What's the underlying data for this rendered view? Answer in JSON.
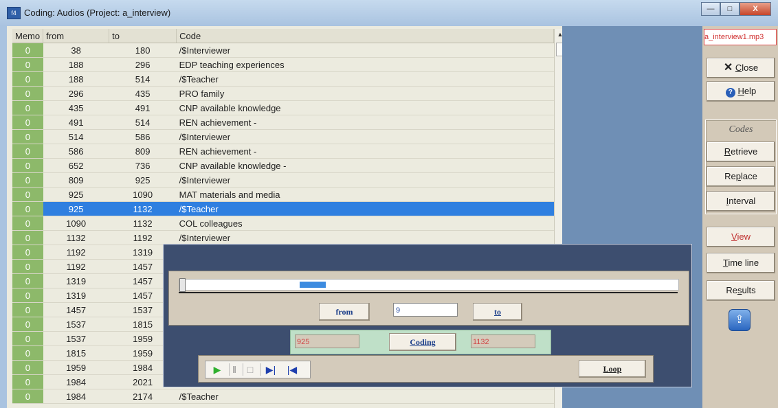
{
  "window": {
    "title": "Coding: Audios (Project: a_interview)",
    "buttons": {
      "minimize": "—",
      "maximize": "□",
      "close": "X"
    }
  },
  "table": {
    "headers": {
      "memo": "Memo",
      "from": "from",
      "to": "to",
      "code": "Code"
    },
    "rows": [
      {
        "memo": "0",
        "from": "38",
        "to": "180",
        "code": "/$Interviewer"
      },
      {
        "memo": "0",
        "from": "188",
        "to": "296",
        "code": "EDP teaching experiences"
      },
      {
        "memo": "0",
        "from": "188",
        "to": "514",
        "code": "/$Teacher"
      },
      {
        "memo": "0",
        "from": "296",
        "to": "435",
        "code": "PRO family"
      },
      {
        "memo": "0",
        "from": "435",
        "to": "491",
        "code": "CNP available knowledge"
      },
      {
        "memo": "0",
        "from": "491",
        "to": "514",
        "code": "REN achievement -"
      },
      {
        "memo": "0",
        "from": "514",
        "to": "586",
        "code": "/$Interviewer"
      },
      {
        "memo": "0",
        "from": "586",
        "to": "809",
        "code": "REN achievement -"
      },
      {
        "memo": "0",
        "from": "652",
        "to": "736",
        "code": "CNP available knowledge -"
      },
      {
        "memo": "0",
        "from": "809",
        "to": "925",
        "code": "/$Interviewer"
      },
      {
        "memo": "0",
        "from": "925",
        "to": "1090",
        "code": "MAT materials and media"
      },
      {
        "memo": "0",
        "from": "925",
        "to": "1132",
        "code": "/$Teacher"
      },
      {
        "memo": "0",
        "from": "1090",
        "to": "1132",
        "code": "COL colleagues"
      },
      {
        "memo": "0",
        "from": "1132",
        "to": "1192",
        "code": "/$Interviewer"
      },
      {
        "memo": "0",
        "from": "1192",
        "to": "1319",
        "code": ""
      },
      {
        "memo": "0",
        "from": "1192",
        "to": "1457",
        "code": ""
      },
      {
        "memo": "0",
        "from": "1319",
        "to": "1457",
        "code": ""
      },
      {
        "memo": "0",
        "from": "1319",
        "to": "1457",
        "code": ""
      },
      {
        "memo": "0",
        "from": "1457",
        "to": "1537",
        "code": ""
      },
      {
        "memo": "0",
        "from": "1537",
        "to": "1815",
        "code": ""
      },
      {
        "memo": "0",
        "from": "1537",
        "to": "1959",
        "code": ""
      },
      {
        "memo": "0",
        "from": "1815",
        "to": "1959",
        "code": ""
      },
      {
        "memo": "0",
        "from": "1959",
        "to": "1984",
        "code": ""
      },
      {
        "memo": "0",
        "from": "1984",
        "to": "2021",
        "code": ""
      },
      {
        "memo": "0",
        "from": "1984",
        "to": "2174",
        "code": "/$Teacher"
      }
    ],
    "selected_row_index": 11
  },
  "sidebar": {
    "file_name": "a_interview1.mp3",
    "close": {
      "icon": "x-icon",
      "prefix": "",
      "underline": "C",
      "rest": "lose"
    },
    "help": {
      "icon": "help-icon",
      "prefix": "",
      "underline": "H",
      "rest": "elp"
    },
    "codes_label": "Codes",
    "retrieve": {
      "prefix": "",
      "underline": "R",
      "rest": "etrieve"
    },
    "replace": {
      "prefix": "Re",
      "underline": "p",
      "rest": "lace"
    },
    "interval": {
      "prefix": "",
      "underline": "I",
      "rest": "nterval"
    },
    "view": {
      "prefix": "",
      "underline": "V",
      "rest": "iew"
    },
    "timeline": {
      "prefix": "",
      "underline": "T",
      "rest": "ime line"
    },
    "results": {
      "prefix": "Re",
      "underline": "s",
      "rest": "ults"
    },
    "export_icon": "export-icon"
  },
  "player": {
    "from_label": "from",
    "to_label": "to",
    "position_value": "9",
    "coding_from": "925",
    "coding_label": "Coding",
    "coding_to": "1132",
    "loop_label": "Loop",
    "controls": [
      "play-icon",
      "pause-icon",
      "stop-icon",
      "skip-end-icon",
      "skip-start-icon"
    ]
  }
}
